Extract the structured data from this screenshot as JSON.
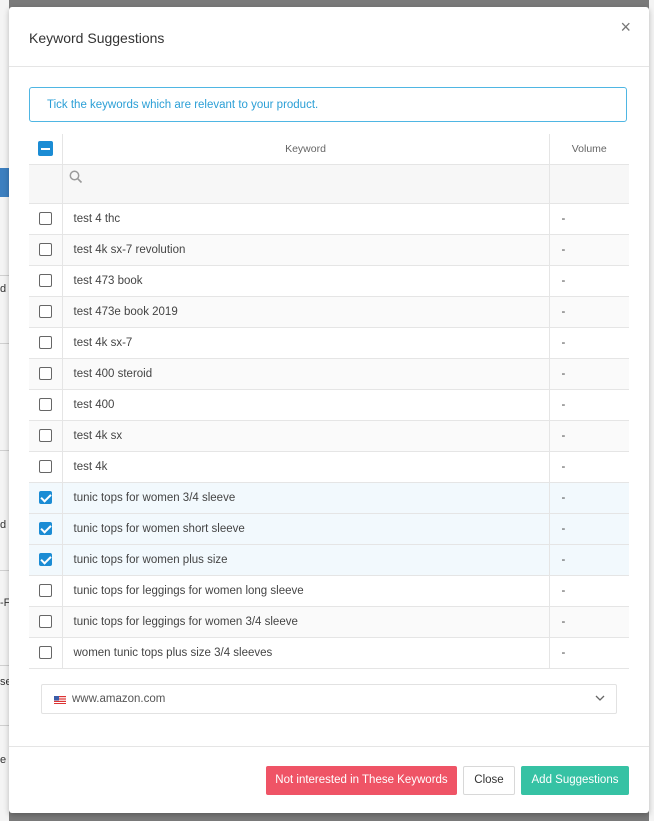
{
  "background": {
    "fragments": [
      "d",
      "d I",
      "-F",
      "se",
      "e V"
    ]
  },
  "modal": {
    "title": "Keyword Suggestions",
    "close_glyph": "×",
    "info_text": "Tick the keywords which are relevant to your product.",
    "table": {
      "headers": {
        "keyword": "Keyword",
        "volume": "Volume"
      },
      "select_all_state": "indeterminate",
      "rows": [
        {
          "keyword": "test 4 thc",
          "volume": "-",
          "checked": false
        },
        {
          "keyword": "test 4k sx-7 revolution",
          "volume": "-",
          "checked": false
        },
        {
          "keyword": "test 473 book",
          "volume": "-",
          "checked": false
        },
        {
          "keyword": "test 473e book 2019",
          "volume": "-",
          "checked": false
        },
        {
          "keyword": "test 4k sx-7",
          "volume": "-",
          "checked": false
        },
        {
          "keyword": "test 400 steroid",
          "volume": "-",
          "checked": false
        },
        {
          "keyword": "test 400",
          "volume": "-",
          "checked": false
        },
        {
          "keyword": "test 4k sx",
          "volume": "-",
          "checked": false
        },
        {
          "keyword": "test 4k",
          "volume": "-",
          "checked": false
        },
        {
          "keyword": "tunic tops for women 3/4 sleeve",
          "volume": "-",
          "checked": true
        },
        {
          "keyword": "tunic tops for women short sleeve",
          "volume": "-",
          "checked": true
        },
        {
          "keyword": "tunic tops for women plus size",
          "volume": "-",
          "checked": true
        },
        {
          "keyword": "tunic tops for leggings for women long sleeve",
          "volume": "-",
          "checked": false
        },
        {
          "keyword": "tunic tops for leggings for women 3/4 sleeve",
          "volume": "-",
          "checked": false
        },
        {
          "keyword": "women tunic tops plus size 3/4 sleeves",
          "volume": "-",
          "checked": false
        }
      ]
    },
    "marketplace": {
      "selected": "www.amazon.com",
      "flag_icon": "us-flag-icon"
    },
    "footer": {
      "not_interested_label": "Not interested in These Keywords",
      "close_label": "Close",
      "add_label": "Add Suggestions"
    }
  },
  "colors": {
    "accent": "#1b8cd4",
    "info": "#2b9fd6",
    "danger": "#ef5466",
    "success": "#36c2a4"
  }
}
